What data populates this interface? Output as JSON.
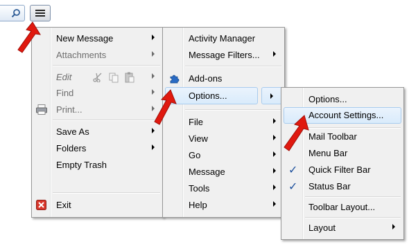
{
  "colors": {
    "arrow": "#e0190f",
    "highlight": "#d9ebfb",
    "menu_bg": "#f0f0f0"
  },
  "toolbar": {
    "search_icon": "search-icon",
    "menu_icon": "hamburger-menu-icon"
  },
  "main_menu": {
    "items": [
      {
        "label": "New Message"
      },
      {
        "label": "Attachments"
      },
      {
        "label": "Edit"
      },
      {
        "label": "Find"
      },
      {
        "label": "Print..."
      },
      {
        "label": "Save As"
      },
      {
        "label": "Folders"
      },
      {
        "label": "Empty Trash"
      },
      {
        "label": "Exit"
      }
    ]
  },
  "tools_menu": {
    "items": [
      {
        "label": "Activity Manager"
      },
      {
        "label": "Message Filters..."
      },
      {
        "label": "Add-ons"
      },
      {
        "label": "Options..."
      },
      {
        "label": "File"
      },
      {
        "label": "View"
      },
      {
        "label": "Go"
      },
      {
        "label": "Message"
      },
      {
        "label": "Tools"
      },
      {
        "label": "Help"
      }
    ]
  },
  "options_menu": {
    "items": [
      {
        "label": "Options..."
      },
      {
        "label": "Account Settings..."
      },
      {
        "label": "Mail Toolbar",
        "checked": false
      },
      {
        "label": "Menu Bar",
        "checked": false
      },
      {
        "label": "Quick Filter Bar",
        "checked": true
      },
      {
        "label": "Status Bar",
        "checked": true
      },
      {
        "label": "Toolbar Layout..."
      },
      {
        "label": "Layout"
      }
    ]
  }
}
